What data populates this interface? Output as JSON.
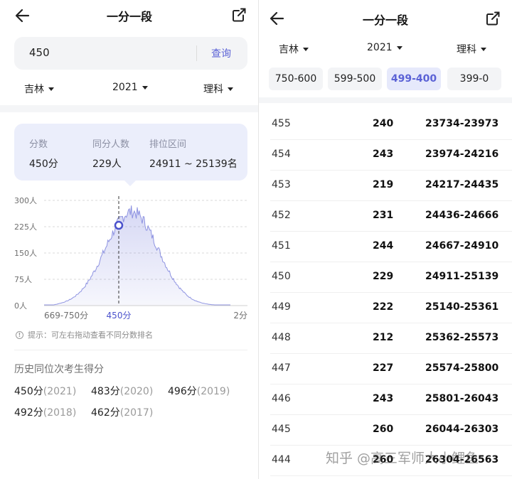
{
  "left": {
    "header": {
      "title": "一分一段"
    },
    "search": {
      "value": "450",
      "button": "查询"
    },
    "filters": {
      "province": "吉林",
      "year": "2021",
      "subject": "理科"
    },
    "stat_card": {
      "score_label": "分数",
      "score_value": "450分",
      "count_label": "同分人数",
      "count_value": "229人",
      "rank_label": "排位区间",
      "rank_value": "24911 ~ 25139名"
    },
    "chart_data": {
      "type": "area",
      "y_ticks": [
        "300人",
        "225人",
        "150人",
        "75人",
        "0人"
      ],
      "ylim": [
        0,
        300
      ],
      "x_labels": {
        "left": "669-750分",
        "marker": "450分",
        "right": "2分"
      },
      "selected": {
        "score": 450,
        "count": 229
      },
      "color": "#6c73d8"
    },
    "tip": "提示：可左右拖动查看不同分数排名",
    "history": {
      "title": "历史同位次考生得分",
      "items": [
        {
          "score": "450分",
          "year": "(2021)"
        },
        {
          "score": "483分",
          "year": "(2020)"
        },
        {
          "score": "496分",
          "year": "(2019)"
        },
        {
          "score": "492分",
          "year": "(2018)"
        },
        {
          "score": "462分",
          "year": "(2017)"
        }
      ]
    }
  },
  "right": {
    "header": {
      "title": "一分一段"
    },
    "filters": {
      "province": "吉林",
      "year": "2021",
      "subject": "理科"
    },
    "tabs": [
      "750-600",
      "599-500",
      "499-400",
      "399-0"
    ],
    "active_tab": "499-400",
    "rows": [
      {
        "score": "455",
        "count": "240",
        "range": "23734-23973"
      },
      {
        "score": "454",
        "count": "243",
        "range": "23974-24216"
      },
      {
        "score": "453",
        "count": "219",
        "range": "24217-24435"
      },
      {
        "score": "452",
        "count": "231",
        "range": "24436-24666"
      },
      {
        "score": "451",
        "count": "244",
        "range": "24667-24910"
      },
      {
        "score": "450",
        "count": "229",
        "range": "24911-25139"
      },
      {
        "score": "449",
        "count": "222",
        "range": "25140-25361"
      },
      {
        "score": "448",
        "count": "212",
        "range": "25362-25573"
      },
      {
        "score": "447",
        "count": "227",
        "range": "25574-25800"
      },
      {
        "score": "446",
        "count": "243",
        "range": "25801-26043"
      },
      {
        "score": "445",
        "count": "260",
        "range": "26044-26303"
      },
      {
        "score": "444",
        "count": "260",
        "range": "26304-26563"
      }
    ]
  },
  "watermark": "知乎 @高三军师大小鲤鱼"
}
